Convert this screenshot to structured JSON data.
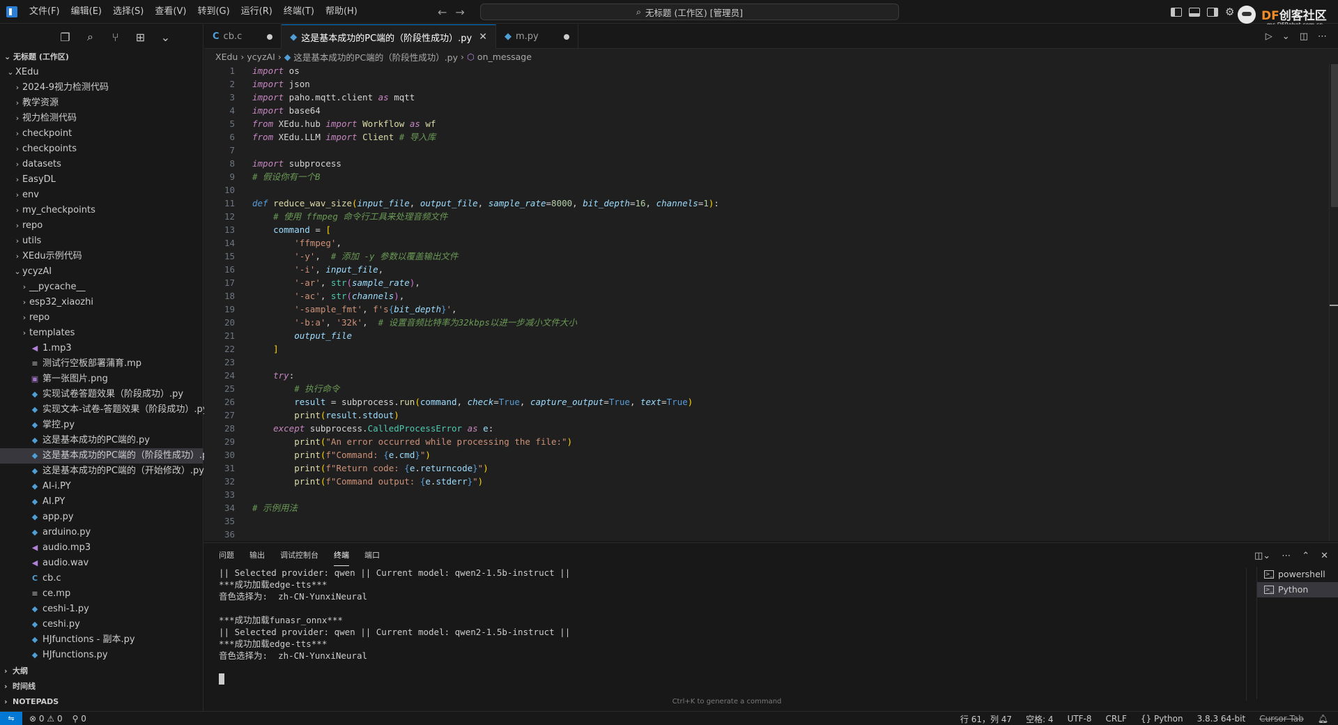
{
  "titlebar": {
    "menu": [
      "文件(F)",
      "编辑(E)",
      "选择(S)",
      "查看(V)",
      "转到(G)",
      "运行(R)",
      "终端(T)",
      "帮助(H)"
    ],
    "search_text": "无标题 (工作区) [管理员]",
    "back_arrow": "←",
    "forward_arrow": "→",
    "watermark": {
      "brand_df": "DF",
      "brand_cn": "创客社区",
      "url": "mc.DFRobot.com.cn"
    }
  },
  "sidebar": {
    "workspace": "无标题 (工作区)",
    "tree": [
      {
        "label": "XEdu",
        "type": "folder-open",
        "depth": 0
      },
      {
        "label": "2024-9视力检测代码",
        "type": "folder",
        "depth": 1
      },
      {
        "label": "教学资源",
        "type": "folder",
        "depth": 1
      },
      {
        "label": "视力检测代码",
        "type": "folder",
        "depth": 1
      },
      {
        "label": "checkpoint",
        "type": "folder",
        "depth": 1
      },
      {
        "label": "checkpoints",
        "type": "folder",
        "depth": 1
      },
      {
        "label": "datasets",
        "type": "folder",
        "depth": 1
      },
      {
        "label": "EasyDL",
        "type": "folder",
        "depth": 1
      },
      {
        "label": "env",
        "type": "folder",
        "depth": 1
      },
      {
        "label": "my_checkpoints",
        "type": "folder",
        "depth": 1
      },
      {
        "label": "repo",
        "type": "folder",
        "depth": 1
      },
      {
        "label": "utils",
        "type": "folder",
        "depth": 1
      },
      {
        "label": "XEdu示例代码",
        "type": "folder",
        "depth": 1
      },
      {
        "label": "ycyzAI",
        "type": "folder-open",
        "depth": 1
      },
      {
        "label": "__pycache__",
        "type": "folder",
        "depth": 2
      },
      {
        "label": "esp32_xiaozhi",
        "type": "folder",
        "depth": 2
      },
      {
        "label": "repo",
        "type": "folder",
        "depth": 2
      },
      {
        "label": "templates",
        "type": "folder",
        "depth": 2
      },
      {
        "label": "1.mp3",
        "type": "audio",
        "depth": 2
      },
      {
        "label": "测试行空板部署蒲育.mp",
        "type": "txt",
        "depth": 2
      },
      {
        "label": "第一张图片.png",
        "type": "img",
        "depth": 2
      },
      {
        "label": "实现试卷答题效果（阶段成功）.py",
        "type": "py",
        "depth": 2
      },
      {
        "label": "实现文本-试卷-答题效果（阶段成功）.py",
        "type": "py",
        "depth": 2
      },
      {
        "label": "掌控.py",
        "type": "py",
        "depth": 2
      },
      {
        "label": "这是基本成功的PC端的.py",
        "type": "py",
        "depth": 2
      },
      {
        "label": "这是基本成功的PC端的（阶段性成功）.py",
        "type": "py",
        "depth": 2,
        "selected": true
      },
      {
        "label": "这是基本成功的PC端的（开始修改）.py",
        "type": "py",
        "depth": 2
      },
      {
        "label": "AI-i.PY",
        "type": "py",
        "depth": 2
      },
      {
        "label": "AI.PY",
        "type": "py",
        "depth": 2
      },
      {
        "label": "app.py",
        "type": "py",
        "depth": 2
      },
      {
        "label": "arduino.py",
        "type": "py",
        "depth": 2
      },
      {
        "label": "audio.mp3",
        "type": "audio",
        "depth": 2
      },
      {
        "label": "audio.wav",
        "type": "audio",
        "depth": 2
      },
      {
        "label": "cb.c",
        "type": "c",
        "depth": 2
      },
      {
        "label": "ce.mp",
        "type": "txt",
        "depth": 2
      },
      {
        "label": "ceshi-1.py",
        "type": "py",
        "depth": 2
      },
      {
        "label": "ceshi.py",
        "type": "py",
        "depth": 2
      },
      {
        "label": "HJfunctions - 副本.py",
        "type": "py",
        "depth": 2
      },
      {
        "label": "HJfunctions.py",
        "type": "py",
        "depth": 2
      }
    ],
    "sections": [
      "大纲",
      "时间线",
      "NOTEPADS"
    ]
  },
  "tabs": [
    {
      "label": "cb.c",
      "icon": "C",
      "modified": true,
      "active": false
    },
    {
      "label": "这是基本成功的PC端的（阶段性成功）.py",
      "icon": "py",
      "modified": false,
      "active": true
    },
    {
      "label": "m.py",
      "icon": "py",
      "modified": true,
      "active": false
    }
  ],
  "breadcrumb": [
    "XEdu",
    "ycyzAI",
    "这是基本成功的PC端的（阶段性成功）.py",
    "on_message"
  ],
  "panel": {
    "tabs": [
      "问题",
      "输出",
      "调试控制台",
      "终端",
      "端口"
    ],
    "active_tab": "终端",
    "terminal_lines": [
      "|| Selected provider: qwen || Current model: qwen2-1.5b-instruct ||",
      "***成功加载edge-tts***",
      "音色选择为:  zh-CN-YunxiNeural",
      "",
      "***成功加载funasr_onnx***",
      "|| Selected provider: qwen || Current model: qwen2-1.5b-instruct ||",
      "***成功加载edge-tts***",
      "音色选择为:  zh-CN-YunxiNeural"
    ],
    "hint": "Ctrl+K to generate a command",
    "terminals": [
      "powershell",
      "Python"
    ]
  },
  "statusbar": {
    "errors": "0",
    "warnings": "0",
    "ports": "0",
    "position": "行 61，列 47",
    "spaces": "空格: 4",
    "encoding": "UTF-8",
    "eol": "CRLF",
    "language": "Python",
    "interpreter": "3.8.3 64-bit",
    "cursor_tab": "Cursor Tab"
  }
}
